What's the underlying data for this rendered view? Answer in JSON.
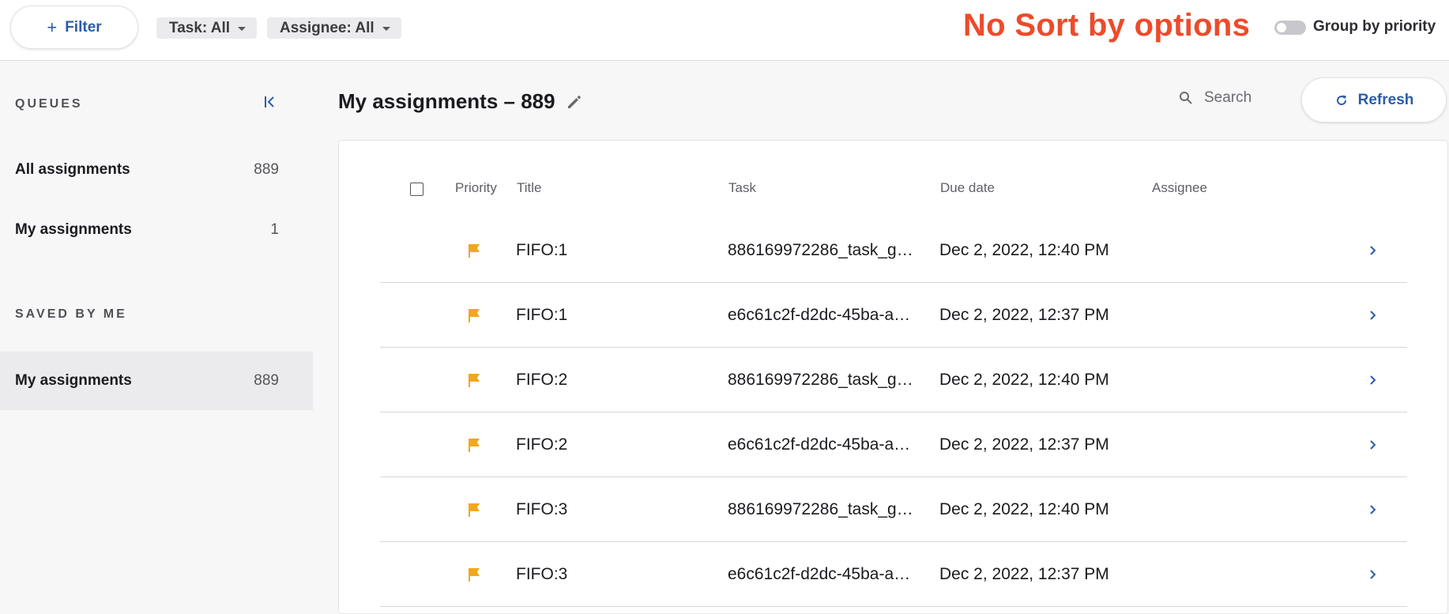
{
  "topbar": {
    "filter_label": "Filter",
    "task_chip": "Task: All",
    "assignee_chip": "Assignee: All",
    "annotation": "No Sort by options",
    "group_toggle_label": "Group by priority",
    "group_toggle_on": false
  },
  "sidebar": {
    "queues_title": "QUEUES",
    "saved_title": "SAVED BY ME",
    "queues": [
      {
        "label": "All assignments",
        "count": "889"
      },
      {
        "label": "My assignments",
        "count": "1"
      }
    ],
    "saved": [
      {
        "label": "My assignments",
        "count": "889",
        "active": true
      }
    ]
  },
  "main": {
    "title": "My assignments – 889",
    "search_placeholder": "Search",
    "refresh_label": "Refresh",
    "columns": [
      "Priority",
      "Title",
      "Task",
      "Due date",
      "Assignee"
    ],
    "rows": [
      {
        "title": "FIFO:1",
        "task": "886169972286_task_g…",
        "due": "Dec 2, 2022, 12:40 PM",
        "assignee": ""
      },
      {
        "title": "FIFO:1",
        "task": "e6c61c2f-d2dc-45ba-a…",
        "due": "Dec 2, 2022, 12:37 PM",
        "assignee": ""
      },
      {
        "title": "FIFO:2",
        "task": "886169972286_task_g…",
        "due": "Dec 2, 2022, 12:40 PM",
        "assignee": ""
      },
      {
        "title": "FIFO:2",
        "task": "e6c61c2f-d2dc-45ba-a…",
        "due": "Dec 2, 2022, 12:37 PM",
        "assignee": ""
      },
      {
        "title": "FIFO:3",
        "task": "886169972286_task_g…",
        "due": "Dec 2, 2022, 12:40 PM",
        "assignee": ""
      },
      {
        "title": "FIFO:3",
        "task": "e6c61c2f-d2dc-45ba-a…",
        "due": "Dec 2, 2022, 12:37 PM",
        "assignee": ""
      }
    ]
  },
  "colors": {
    "accent": "#2b5ca8",
    "flag": "#f0a81c",
    "annotation": "#ee4a2b"
  },
  "icons": [
    "plus-icon",
    "caret-down-icon",
    "collapse-left-icon",
    "pencil-icon",
    "search-icon",
    "refresh-icon",
    "flag-icon",
    "chevron-right-icon"
  ]
}
